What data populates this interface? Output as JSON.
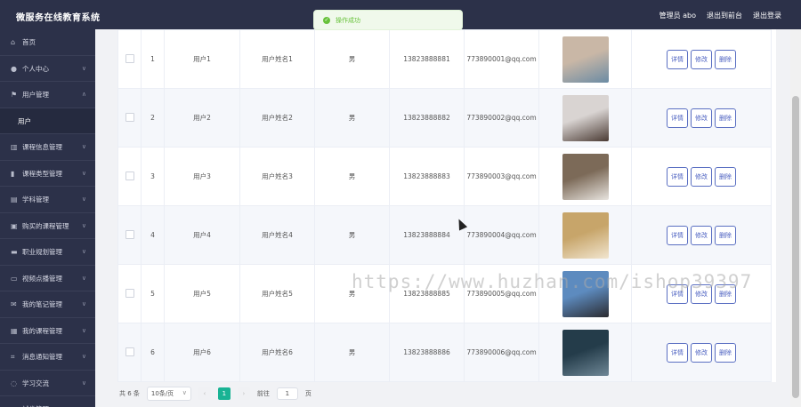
{
  "header": {
    "title": "微服务在线教育系统",
    "admin": "管理员 abo",
    "front": "退出到前台",
    "logout": "退出登录"
  },
  "toast": {
    "message": "操作成功"
  },
  "sidebar": {
    "items": [
      {
        "label": "首页",
        "icon": "home-icon",
        "chev": ""
      },
      {
        "label": "个人中心",
        "icon": "user-icon",
        "chev": "∨"
      },
      {
        "label": "用户管理",
        "icon": "flag-icon",
        "chev": "∧"
      },
      {
        "label": "用户",
        "icon": "",
        "chev": "",
        "sub": true
      },
      {
        "label": "课程信息管理",
        "icon": "bank-icon",
        "chev": "∨"
      },
      {
        "label": "课程类型管理",
        "icon": "bar-chart-icon",
        "chev": "∨"
      },
      {
        "label": "学科管理",
        "icon": "document-icon",
        "chev": "∨"
      },
      {
        "label": "购买的课程管理",
        "icon": "cart-icon",
        "chev": "∨"
      },
      {
        "label": "职业规划管理",
        "icon": "monitor-icon",
        "chev": "∨"
      },
      {
        "label": "视频点播管理",
        "icon": "video-icon",
        "chev": "∨"
      },
      {
        "label": "我的笔记管理",
        "icon": "mail-icon",
        "chev": "∨"
      },
      {
        "label": "我的课程管理",
        "icon": "grid-icon",
        "chev": "∨"
      },
      {
        "label": "消息通知管理",
        "icon": "crop-icon",
        "chev": "∨"
      },
      {
        "label": "学习交流",
        "icon": "chat-icon",
        "chev": "∨"
      },
      {
        "label": "试卷管理",
        "icon": "paper-icon",
        "chev": "∨"
      }
    ]
  },
  "table": {
    "rows": [
      {
        "no": "1",
        "account": "用户1",
        "name": "用户姓名1",
        "gender": "男",
        "phone": "13823888881",
        "email": "773890001@qq.com",
        "photo_colors": [
          "#c9b7a6",
          "#6b8ba4"
        ]
      },
      {
        "no": "2",
        "account": "用户2",
        "name": "用户姓名2",
        "gender": "男",
        "phone": "13823888882",
        "email": "773890002@qq.com",
        "photo_colors": [
          "#d9d4d2",
          "#4a3a33"
        ]
      },
      {
        "no": "3",
        "account": "用户3",
        "name": "用户姓名3",
        "gender": "男",
        "phone": "13823888883",
        "email": "773890003@qq.com",
        "photo_colors": [
          "#7c6a58",
          "#e8e4df"
        ]
      },
      {
        "no": "4",
        "account": "用户4",
        "name": "用户姓名4",
        "gender": "男",
        "phone": "13823888884",
        "email": "773890004@qq.com",
        "photo_colors": [
          "#c7a56a",
          "#f1e5cf"
        ]
      },
      {
        "no": "5",
        "account": "用户5",
        "name": "用户姓名5",
        "gender": "男",
        "phone": "13823888885",
        "email": "773890005@qq.com",
        "photo_colors": [
          "#5d8bbf",
          "#2b2b30"
        ]
      },
      {
        "no": "6",
        "account": "用户6",
        "name": "用户姓名6",
        "gender": "男",
        "phone": "13823888886",
        "email": "773890006@qq.com",
        "photo_colors": [
          "#243c4a",
          "#6f8796"
        ]
      }
    ],
    "buttons": {
      "detail": "详情",
      "edit": "修改",
      "delete": "删除"
    }
  },
  "pagination": {
    "total": "共 6 条",
    "page_size": "10条/页",
    "prev": "‹",
    "current": "1",
    "next": "›",
    "goto": "前往",
    "goto_value": "1",
    "page_unit": "页"
  },
  "watermark": "https://www.huzhan.com/ishop39397"
}
